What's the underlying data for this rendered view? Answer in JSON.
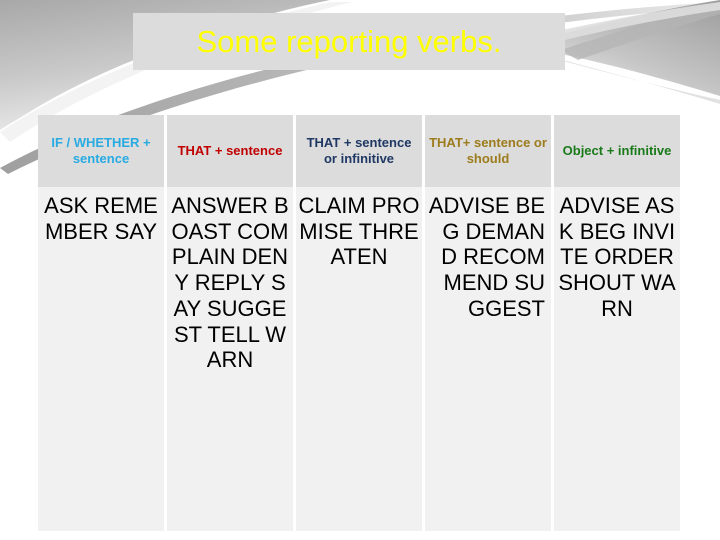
{
  "slide": {
    "title": "Some reporting verbs.",
    "title_color": "#ffff00",
    "title_background": "#dcdcdc",
    "background": "#ffffff"
  },
  "table": {
    "header_background": "#dcdcdc",
    "cell_background": "#f1f1f1",
    "columns": [
      {
        "header": "IF / WHETHER + sentence",
        "color": "#29abe2",
        "align": "center",
        "verbs": [
          "ASK",
          "REMEMBER",
          "SAY"
        ],
        "verbs_text": "ASK REMEMBER SAY"
      },
      {
        "header": "THAT + sentence",
        "color": "#c00000",
        "align": "center",
        "verbs": [
          "ANSWER",
          "BOAST",
          "COMPLAIN",
          "DENY",
          "REPLY",
          "SAY",
          "SUGGEST",
          "TELL",
          "WARN"
        ],
        "verbs_text": "ANSWER BOAST COMPLAIN DENY REPLY SAY SUGGEST TELL WARN"
      },
      {
        "header": "THAT + sentence or infinitive",
        "color": "#1f3864",
        "align": "center",
        "verbs": [
          "CLAIM",
          "PROMISE",
          "THREATEN"
        ],
        "verbs_text": "CLAIM PROMISE THREATEN"
      },
      {
        "header": "THAT+ sentence or should",
        "color": "#9c7c1c",
        "align": "right",
        "verbs": [
          "ADVISE",
          "BEG",
          "DEMAND",
          "RECOMMEND",
          "SUGGEST"
        ],
        "verbs_text": "ADVISE BEG DEMAND RECOMMEND SUGGEST"
      },
      {
        "header": "Object + infinitive",
        "color": "#1a7a1a",
        "align": "center",
        "verbs": [
          "ADVISE",
          "ASK",
          "BEG",
          "INVITE",
          "ORDER",
          "SHOUT",
          "WARN"
        ],
        "verbs_text": "ADVISE ASK BEG INVITE ORDER SHOUT WARN"
      }
    ]
  }
}
